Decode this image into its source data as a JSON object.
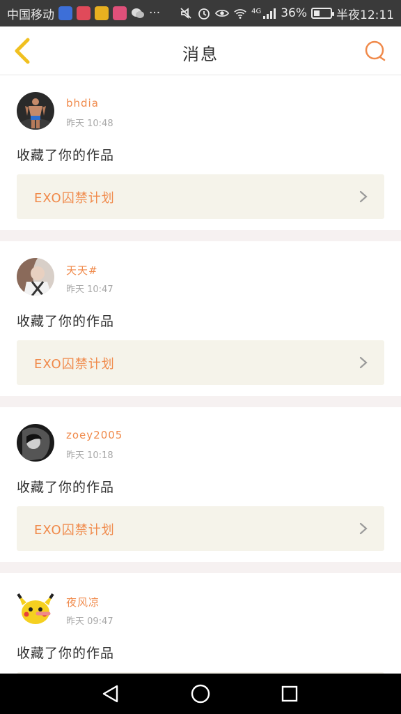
{
  "status_bar": {
    "carrier": "中国移动",
    "network": "4G",
    "battery": "36%",
    "battery_level": 0.36,
    "time": "半夜12:11",
    "more": "···"
  },
  "header": {
    "title": "消息"
  },
  "messages": [
    {
      "username": "bhdia",
      "time": "昨天 10:48",
      "action": "收藏了你的作品",
      "work_title": "EXO囚禁计划"
    },
    {
      "username": "天天#",
      "time": "昨天 10:47",
      "action": "收藏了你的作品",
      "work_title": "EXO囚禁计划"
    },
    {
      "username": "zoey2005",
      "time": "昨天 10:18",
      "action": "收藏了你的作品",
      "work_title": "EXO囚禁计划"
    },
    {
      "username": "夜风凉",
      "time": "昨天 09:47",
      "action": "收藏了你的作品",
      "work_title": ""
    }
  ],
  "colors": {
    "accent": "#f08a4b",
    "back_icon": "#f0c020",
    "card_bg": "#f5f3ea",
    "separator": "#f6f1f1"
  }
}
